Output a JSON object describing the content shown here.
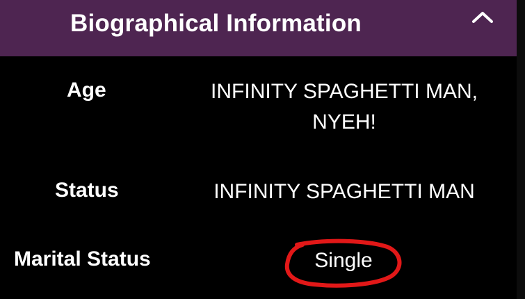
{
  "section": {
    "title": "Biographical Information",
    "toggle_icon": "chevron-up-icon",
    "header_color": "#4e2551"
  },
  "rows": [
    {
      "label": "Age",
      "value": "INFINITY SPAGHETTI MAN, NYEH!"
    },
    {
      "label": "Status",
      "value": "INFINITY SPAGHETTI MAN"
    },
    {
      "label": "Marital Status",
      "value": "Single"
    }
  ],
  "annotation": {
    "shape": "hand-drawn-circle",
    "target": "Single",
    "color": "#e21818"
  }
}
